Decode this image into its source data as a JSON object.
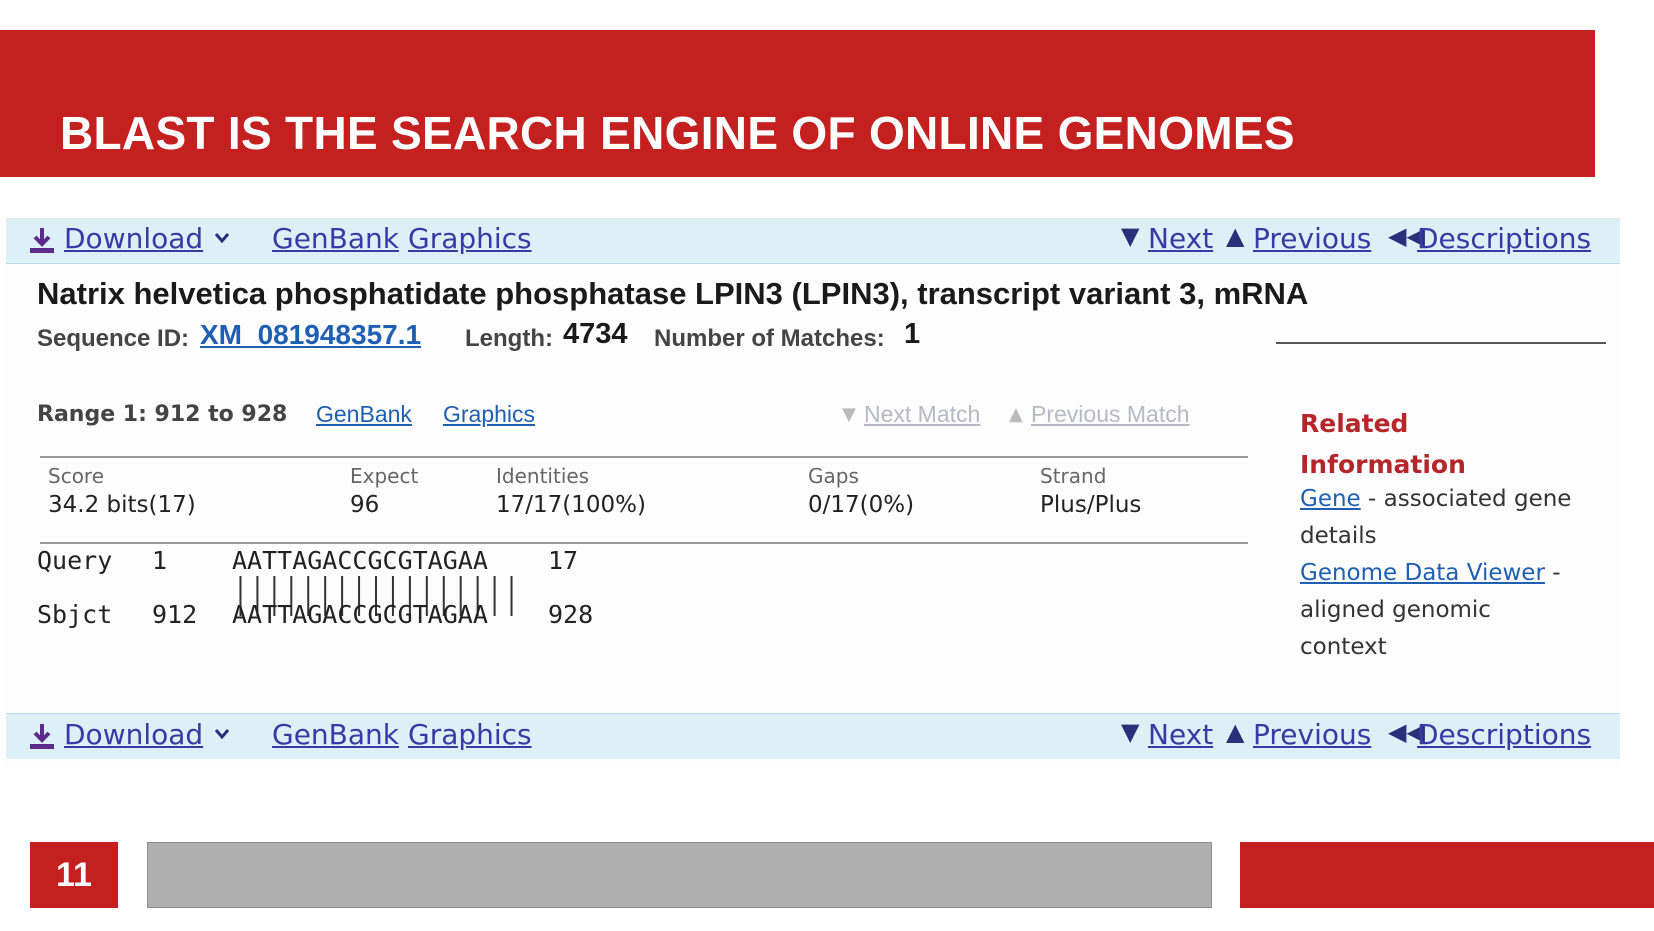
{
  "slide": {
    "title": "BLAST IS THE SEARCH ENGINE OF ONLINE GENOMES",
    "page_number": "11",
    "accent_color": "#c42020"
  },
  "toolbar": {
    "download_label": "Download",
    "genbank_label": "GenBank",
    "graphics_label": "Graphics",
    "next_label": "Next",
    "previous_label": "Previous",
    "descriptions_label": "Descriptions",
    "background_color": "#ddf0f7"
  },
  "result": {
    "title": "Natrix helvetica phosphatidate phosphatase LPIN3 (LPIN3), transcript variant 3, mRNA",
    "sequence_id_label": "Sequence ID:",
    "sequence_id": "XM_081948357.1",
    "length_label": "Length:",
    "length": "4734",
    "matches_label": "Number of Matches:",
    "matches": "1"
  },
  "range": {
    "label": "Range 1: 912 to 928",
    "genbank_label": "GenBank",
    "graphics_label": "Graphics",
    "next_match_label": "Next Match",
    "previous_match_label": "Previous Match"
  },
  "stats": {
    "headers": [
      "Score",
      "Expect",
      "Identities",
      "Gaps",
      "Strand"
    ],
    "values": [
      "34.2 bits(17)",
      "96",
      "17/17(100%)",
      "0/17(0%)",
      "Plus/Plus"
    ]
  },
  "alignment": {
    "query": {
      "label": "Query",
      "start": "1",
      "seq": "AATTAGACCGCGTAGAA",
      "end": "17"
    },
    "sbjct": {
      "label": "Sbjct",
      "start": "912",
      "seq": "AATTAGACCGCGTAGAA",
      "end": "928"
    }
  },
  "related": {
    "heading_line1": "Related",
    "heading_line2": "Information",
    "gene_link": "Gene",
    "gene_desc": " - associated gene",
    "gene_desc2": "details",
    "viewer_link": "Genome Data Viewer",
    "viewer_desc": " -",
    "viewer_desc2": " aligned genomic",
    "viewer_desc3": "context"
  }
}
